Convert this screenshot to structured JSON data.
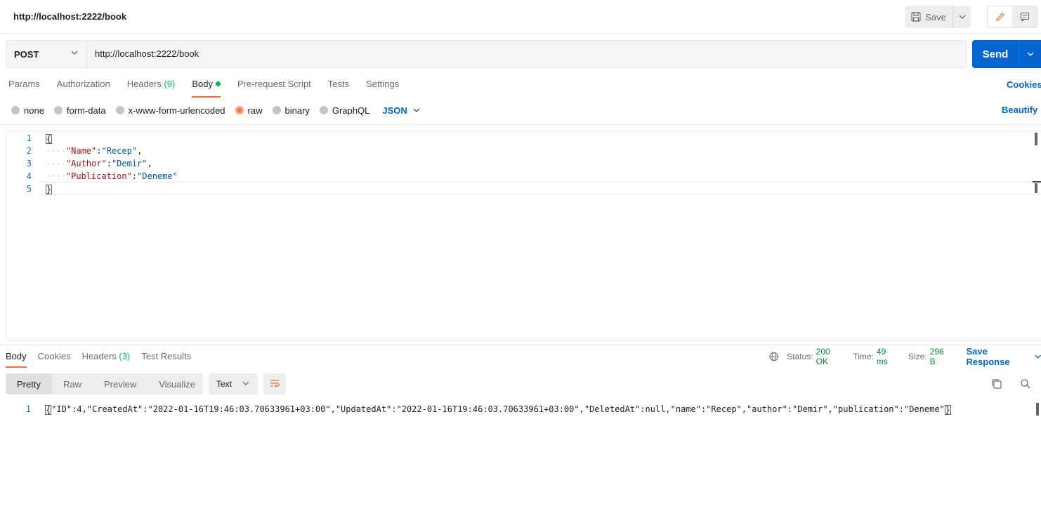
{
  "header": {
    "title": "http://localhost:2222/book",
    "save_label": "Save"
  },
  "request": {
    "method": "POST",
    "url": "http://localhost:2222/book",
    "send_label": "Send",
    "tabs": [
      {
        "label": "Params"
      },
      {
        "label": "Authorization"
      },
      {
        "label": "Headers",
        "count": "(9)"
      },
      {
        "label": "Body",
        "active": true
      },
      {
        "label": "Pre-request Script"
      },
      {
        "label": "Tests"
      },
      {
        "label": "Settings"
      }
    ],
    "cookies_label": "Cookies",
    "body_modes": [
      "none",
      "form-data",
      "x-www-form-urlencoded",
      "raw",
      "binary",
      "GraphQL"
    ],
    "selected_body_mode": "raw",
    "language": "JSON",
    "beautify_label": "Beautify",
    "body_lines": [
      {
        "n": "1",
        "text": "{"
      },
      {
        "n": "2",
        "key": "\"Name\"",
        "value": "\"Recep\"",
        "trail": ","
      },
      {
        "n": "3",
        "key": "\"Author\"",
        "value": "\"Demir\"",
        "trail": ","
      },
      {
        "n": "4",
        "key": "\"Publication\"",
        "value": "\"Deneme\"",
        "trail": ""
      },
      {
        "n": "5",
        "text": "}"
      }
    ]
  },
  "response": {
    "tabs": [
      {
        "label": "Body",
        "active": true
      },
      {
        "label": "Cookies"
      },
      {
        "label": "Headers",
        "count": "(3)"
      },
      {
        "label": "Test Results"
      }
    ],
    "status_label": "Status:",
    "status_value": "200 OK",
    "time_label": "Time:",
    "time_value": "49 ms",
    "size_label": "Size:",
    "size_value": "296 B",
    "save_response_label": "Save Response",
    "views": [
      "Pretty",
      "Raw",
      "Preview",
      "Visualize"
    ],
    "active_view": "Pretty",
    "format": "Text",
    "line_number": "1",
    "body_text": "\"ID\":4,\"CreatedAt\":\"2022-01-16T19:46:03.70633961+03:00\",\"UpdatedAt\":\"2022-01-16T19:46:03.70633961+03:00\",\"DeletedAt\":null,\"name\":\"Recep\",\"author\":\"Demir\",\"publication\":\"Deneme\""
  },
  "colors": {
    "accent": "#ff6c37",
    "primary": "#0265d2",
    "success": "#0cbb52"
  }
}
